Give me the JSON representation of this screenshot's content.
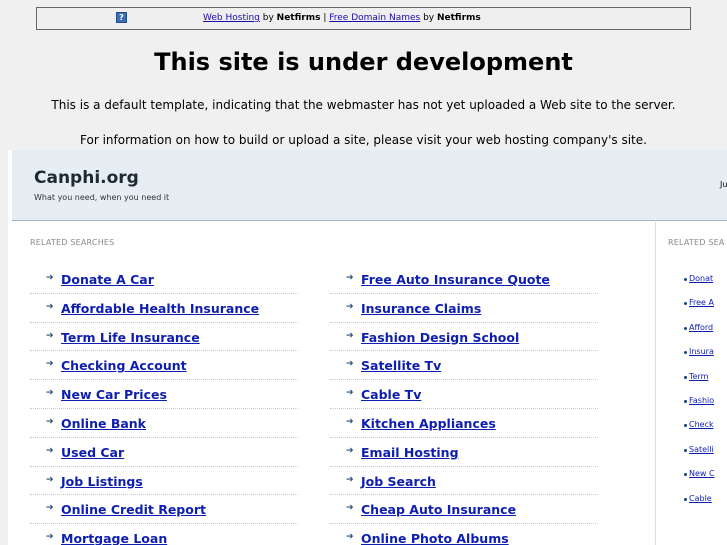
{
  "topbar": {
    "icon": "question-icon",
    "link1": "Web Hosting",
    "by1": " by ",
    "brand1": "Netfirms",
    "sep": " | ",
    "link2": "Free Domain Names",
    "by2": " by ",
    "brand2": "Netfirms"
  },
  "dev": {
    "title": "This site is under development",
    "line1": "This is a default template, indicating that the webmaster has not yet uploaded a Web site to the server.",
    "line2": "For information on how to build or upload a site, please visit your web hosting company's site."
  },
  "parked": {
    "domain": "Canphi.org",
    "tagline": "What you need, when you need it",
    "header_right": "Ju",
    "related_label": "RELATED SEARCHES",
    "related_label_side": "RELATED SEA",
    "col1": [
      "Donate A Car",
      "Affordable Health Insurance",
      "Term Life Insurance",
      "Checking Account",
      "New Car Prices",
      "Online Bank",
      "Used Car",
      "Job Listings",
      "Online Credit Report",
      "Mortgage Loan"
    ],
    "col2": [
      "Free Auto Insurance Quote",
      "Insurance Claims",
      "Fashion Design School",
      "Satellite Tv",
      "Cable Tv",
      "Kitchen Appliances",
      "Email Hosting",
      "Job Search",
      "Cheap Auto Insurance",
      "Online Photo Albums"
    ],
    "side": [
      "Donat",
      "Free A",
      "Afford",
      "Insura",
      "Term",
      "Fashio",
      "Check",
      "Satelli",
      "New C",
      "Cable"
    ]
  }
}
